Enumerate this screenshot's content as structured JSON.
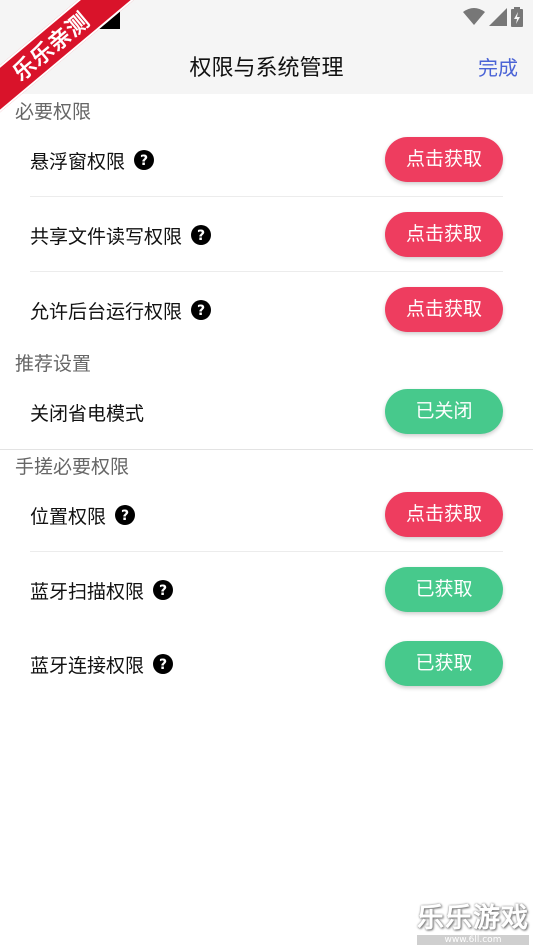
{
  "status_bar": {
    "icons": [
      "wifi-icon",
      "cell-signal-icon",
      "battery-icon"
    ]
  },
  "overlay": {
    "ribbon_text": "乐乐亲测"
  },
  "header": {
    "title": "权限与系统管理",
    "done_label": "完成"
  },
  "sections": [
    {
      "title": "必要权限",
      "items": [
        {
          "label": "悬浮窗权限",
          "button": "点击获取",
          "state": "not-granted",
          "help_icon": true
        },
        {
          "label": "共享文件读写权限",
          "button": "点击获取",
          "state": "not-granted",
          "help_icon": true
        },
        {
          "label": "允许后台运行权限",
          "button": "点击获取",
          "state": "not-granted",
          "help_icon": true
        }
      ]
    },
    {
      "title": "推荐设置",
      "items": [
        {
          "label": "关闭省电模式",
          "button": "已关闭",
          "state": "done",
          "help_icon": false
        }
      ]
    },
    {
      "title": "手搓必要权限",
      "items": [
        {
          "label": "位置权限",
          "button": "点击获取",
          "state": "not-granted",
          "help_icon": true
        },
        {
          "label": "蓝牙扫描权限",
          "button": "已获取",
          "state": "granted",
          "help_icon": true
        },
        {
          "label": "蓝牙连接权限",
          "button": "已获取",
          "state": "granted",
          "help_icon": true
        }
      ]
    }
  ],
  "watermark": {
    "logo_text": "乐乐游戏",
    "url": "www.6ll.com"
  },
  "colors": {
    "accent": "#4a63d6",
    "action_red": "#ee3d5f",
    "done_green": "#47c98c",
    "ribbon": "#d9132a"
  }
}
